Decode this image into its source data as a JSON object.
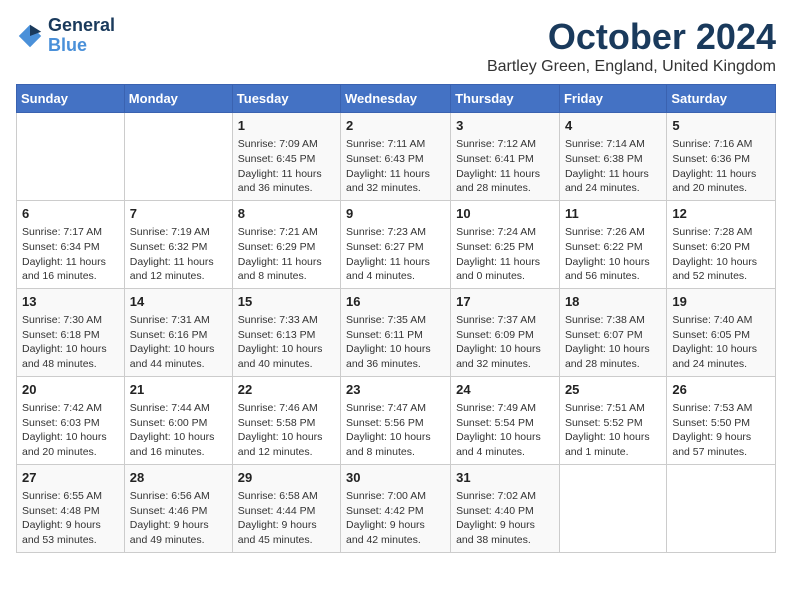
{
  "header": {
    "logo_line1": "General",
    "logo_line2": "Blue",
    "month": "October 2024",
    "location": "Bartley Green, England, United Kingdom"
  },
  "days_of_week": [
    "Sunday",
    "Monday",
    "Tuesday",
    "Wednesday",
    "Thursday",
    "Friday",
    "Saturday"
  ],
  "weeks": [
    [
      {
        "day": "",
        "info": ""
      },
      {
        "day": "",
        "info": ""
      },
      {
        "day": "1",
        "info": "Sunrise: 7:09 AM\nSunset: 6:45 PM\nDaylight: 11 hours and 36 minutes."
      },
      {
        "day": "2",
        "info": "Sunrise: 7:11 AM\nSunset: 6:43 PM\nDaylight: 11 hours and 32 minutes."
      },
      {
        "day": "3",
        "info": "Sunrise: 7:12 AM\nSunset: 6:41 PM\nDaylight: 11 hours and 28 minutes."
      },
      {
        "day": "4",
        "info": "Sunrise: 7:14 AM\nSunset: 6:38 PM\nDaylight: 11 hours and 24 minutes."
      },
      {
        "day": "5",
        "info": "Sunrise: 7:16 AM\nSunset: 6:36 PM\nDaylight: 11 hours and 20 minutes."
      }
    ],
    [
      {
        "day": "6",
        "info": "Sunrise: 7:17 AM\nSunset: 6:34 PM\nDaylight: 11 hours and 16 minutes."
      },
      {
        "day": "7",
        "info": "Sunrise: 7:19 AM\nSunset: 6:32 PM\nDaylight: 11 hours and 12 minutes."
      },
      {
        "day": "8",
        "info": "Sunrise: 7:21 AM\nSunset: 6:29 PM\nDaylight: 11 hours and 8 minutes."
      },
      {
        "day": "9",
        "info": "Sunrise: 7:23 AM\nSunset: 6:27 PM\nDaylight: 11 hours and 4 minutes."
      },
      {
        "day": "10",
        "info": "Sunrise: 7:24 AM\nSunset: 6:25 PM\nDaylight: 11 hours and 0 minutes."
      },
      {
        "day": "11",
        "info": "Sunrise: 7:26 AM\nSunset: 6:22 PM\nDaylight: 10 hours and 56 minutes."
      },
      {
        "day": "12",
        "info": "Sunrise: 7:28 AM\nSunset: 6:20 PM\nDaylight: 10 hours and 52 minutes."
      }
    ],
    [
      {
        "day": "13",
        "info": "Sunrise: 7:30 AM\nSunset: 6:18 PM\nDaylight: 10 hours and 48 minutes."
      },
      {
        "day": "14",
        "info": "Sunrise: 7:31 AM\nSunset: 6:16 PM\nDaylight: 10 hours and 44 minutes."
      },
      {
        "day": "15",
        "info": "Sunrise: 7:33 AM\nSunset: 6:13 PM\nDaylight: 10 hours and 40 minutes."
      },
      {
        "day": "16",
        "info": "Sunrise: 7:35 AM\nSunset: 6:11 PM\nDaylight: 10 hours and 36 minutes."
      },
      {
        "day": "17",
        "info": "Sunrise: 7:37 AM\nSunset: 6:09 PM\nDaylight: 10 hours and 32 minutes."
      },
      {
        "day": "18",
        "info": "Sunrise: 7:38 AM\nSunset: 6:07 PM\nDaylight: 10 hours and 28 minutes."
      },
      {
        "day": "19",
        "info": "Sunrise: 7:40 AM\nSunset: 6:05 PM\nDaylight: 10 hours and 24 minutes."
      }
    ],
    [
      {
        "day": "20",
        "info": "Sunrise: 7:42 AM\nSunset: 6:03 PM\nDaylight: 10 hours and 20 minutes."
      },
      {
        "day": "21",
        "info": "Sunrise: 7:44 AM\nSunset: 6:00 PM\nDaylight: 10 hours and 16 minutes."
      },
      {
        "day": "22",
        "info": "Sunrise: 7:46 AM\nSunset: 5:58 PM\nDaylight: 10 hours and 12 minutes."
      },
      {
        "day": "23",
        "info": "Sunrise: 7:47 AM\nSunset: 5:56 PM\nDaylight: 10 hours and 8 minutes."
      },
      {
        "day": "24",
        "info": "Sunrise: 7:49 AM\nSunset: 5:54 PM\nDaylight: 10 hours and 4 minutes."
      },
      {
        "day": "25",
        "info": "Sunrise: 7:51 AM\nSunset: 5:52 PM\nDaylight: 10 hours and 1 minute."
      },
      {
        "day": "26",
        "info": "Sunrise: 7:53 AM\nSunset: 5:50 PM\nDaylight: 9 hours and 57 minutes."
      }
    ],
    [
      {
        "day": "27",
        "info": "Sunrise: 6:55 AM\nSunset: 4:48 PM\nDaylight: 9 hours and 53 minutes."
      },
      {
        "day": "28",
        "info": "Sunrise: 6:56 AM\nSunset: 4:46 PM\nDaylight: 9 hours and 49 minutes."
      },
      {
        "day": "29",
        "info": "Sunrise: 6:58 AM\nSunset: 4:44 PM\nDaylight: 9 hours and 45 minutes."
      },
      {
        "day": "30",
        "info": "Sunrise: 7:00 AM\nSunset: 4:42 PM\nDaylight: 9 hours and 42 minutes."
      },
      {
        "day": "31",
        "info": "Sunrise: 7:02 AM\nSunset: 4:40 PM\nDaylight: 9 hours and 38 minutes."
      },
      {
        "day": "",
        "info": ""
      },
      {
        "day": "",
        "info": ""
      }
    ]
  ]
}
